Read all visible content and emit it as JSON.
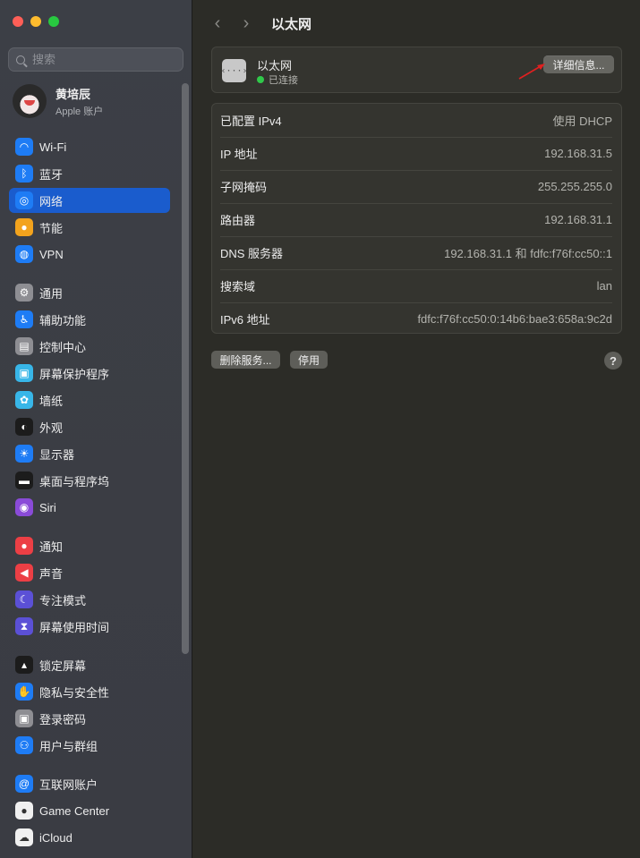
{
  "window": {
    "title": "以太网"
  },
  "search": {
    "placeholder": "搜索"
  },
  "account": {
    "name": "黄培辰",
    "subtitle": "Apple 账户"
  },
  "sidebar": {
    "items": [
      {
        "label": "Wi-Fi",
        "icon": "wifi-icon",
        "color": "#1e7cf5"
      },
      {
        "label": "蓝牙",
        "icon": "bluetooth-icon",
        "color": "#1e7cf5"
      },
      {
        "label": "网络",
        "icon": "globe-icon",
        "color": "#1e7cf5",
        "active": true
      },
      {
        "label": "节能",
        "icon": "lightbulb-icon",
        "color": "#f3a31d"
      },
      {
        "label": "VPN",
        "icon": "vpn-icon",
        "color": "#1e7cf5"
      },
      {
        "label": "通用",
        "icon": "gear-icon",
        "color": "#8e8e93"
      },
      {
        "label": "辅助功能",
        "icon": "accessibility-icon",
        "color": "#1e7cf5"
      },
      {
        "label": "控制中心",
        "icon": "control-center-icon",
        "color": "#8e8e93"
      },
      {
        "label": "屏幕保护程序",
        "icon": "screensaver-icon",
        "color": "#38b6e8"
      },
      {
        "label": "墙纸",
        "icon": "wallpaper-icon",
        "color": "#38b6e8"
      },
      {
        "label": "外观",
        "icon": "appearance-icon",
        "color": "#1c1c1c"
      },
      {
        "label": "显示器",
        "icon": "display-icon",
        "color": "#1e7cf5"
      },
      {
        "label": "桌面与程序坞",
        "icon": "dock-icon",
        "color": "#1c1c1c"
      },
      {
        "label": "Siri",
        "icon": "siri-icon",
        "color": "#8a4bd8"
      },
      {
        "label": "通知",
        "icon": "bell-icon",
        "color": "#ec3f45"
      },
      {
        "label": "声音",
        "icon": "speaker-icon",
        "color": "#ec3f45"
      },
      {
        "label": "专注模式",
        "icon": "moon-icon",
        "color": "#5b50d6"
      },
      {
        "label": "屏幕使用时间",
        "icon": "hourglass-icon",
        "color": "#5b50d6"
      },
      {
        "label": "锁定屏幕",
        "icon": "lock-screen-icon",
        "color": "#1c1c1c"
      },
      {
        "label": "隐私与安全性",
        "icon": "hand-icon",
        "color": "#1e7cf5"
      },
      {
        "label": "登录密码",
        "icon": "lock-icon",
        "color": "#8e8e93"
      },
      {
        "label": "用户与群组",
        "icon": "users-icon",
        "color": "#1e7cf5"
      },
      {
        "label": "互联网账户",
        "icon": "at-icon",
        "color": "#1e7cf5"
      },
      {
        "label": "Game Center",
        "icon": "game-center-icon",
        "color": "#f0f0f0"
      },
      {
        "label": "iCloud",
        "icon": "cloud-icon",
        "color": "#f0f0f0"
      }
    ]
  },
  "header": {
    "name": "以太网",
    "status": "已连接",
    "details_button": "详细信息...",
    "icon_glyph": "‹···›"
  },
  "info_rows": [
    {
      "label": "已配置 IPv4",
      "value": "使用 DHCP"
    },
    {
      "label": "IP 地址",
      "value": "192.168.31.5"
    },
    {
      "label": "子网掩码",
      "value": "255.255.255.0"
    },
    {
      "label": "路由器",
      "value": "192.168.31.1"
    },
    {
      "label": "DNS 服务器",
      "value": "192.168.31.1 和 fdfc:f76f:cc50::1"
    },
    {
      "label": "搜索域",
      "value": "lan"
    },
    {
      "label": "IPv6 地址",
      "value": "fdfc:f76f:cc50:0:14b6:bae3:658a:9c2d"
    }
  ],
  "buttons": {
    "delete_service": "删除服务...",
    "disable": "停用",
    "help": "?"
  },
  "nav": {
    "back": "‹",
    "forward": "›"
  }
}
